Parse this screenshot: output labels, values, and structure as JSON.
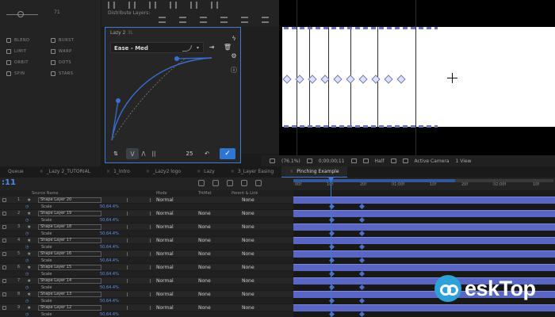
{
  "left_panel": {
    "value": "71",
    "effects": [
      [
        "BLEND",
        "BURST"
      ],
      [
        "LIMIT",
        "WARP"
      ],
      [
        "ORBIT",
        "DOTS"
      ],
      [
        "SPIN",
        "STARS"
      ]
    ]
  },
  "align_panel": {
    "distribute_label": "Distribute Layers:"
  },
  "ease_panel": {
    "title": "Lazy 2",
    "title_sub": "3L",
    "preset": "Ease - Med",
    "frames": "25",
    "footer_buttons": [
      "⇅",
      "\\/",
      "/\\",
      "||"
    ],
    "apply_icon": "✓",
    "undo_icon": "↶",
    "colors": {
      "accent": "#3a7bd5",
      "curve": "#3b6fd4"
    }
  },
  "viewer_toolbar": {
    "zoom": "(76.1%)",
    "timecode": "0;00;00;11",
    "resolution": "Half",
    "camera": "Active Camera",
    "views": "1 View"
  },
  "tabs": [
    {
      "label": "Queue",
      "active": false
    },
    {
      "label": "_Lazy 2_TUTORIAL",
      "active": false
    },
    {
      "label": "1_Intro",
      "active": false
    },
    {
      "label": "_Lazy2 logo",
      "active": false
    },
    {
      "label": "Lazy",
      "active": false
    },
    {
      "label": "3_Layer Easing",
      "active": false
    },
    {
      "label": "Pinching Example",
      "active": true
    }
  ],
  "timeline": {
    "time_display": ":11",
    "ruler_ticks": [
      "00f",
      "10f",
      "20f",
      "01:00f",
      "10f",
      "20f",
      "02:00f",
      "10f"
    ],
    "columns": {
      "source_name": "Source Name",
      "mode": "Mode",
      "trkmat": "TrkMat",
      "parent": "Parent & Link"
    },
    "layers": [
      {
        "num": "1",
        "name": "Shape Layer 20",
        "mode": "Normal",
        "trkmat": "",
        "parent": "None",
        "prop": "Scale",
        "value": "50,64.4%"
      },
      {
        "num": "2",
        "name": "Shape Layer 19",
        "mode": "Normal",
        "trkmat": "None",
        "parent": "None",
        "prop": "Scale",
        "value": "50,64.4%"
      },
      {
        "num": "3",
        "name": "Shape Layer 18",
        "mode": "Normal",
        "trkmat": "None",
        "parent": "None",
        "prop": "Scale",
        "value": "50,64.4%"
      },
      {
        "num": "4",
        "name": "Shape Layer 17",
        "mode": "Normal",
        "trkmat": "None",
        "parent": "None",
        "prop": "Scale",
        "value": "50,64.4%"
      },
      {
        "num": "5",
        "name": "Shape Layer 16",
        "mode": "Normal",
        "trkmat": "None",
        "parent": "None",
        "prop": "Scale",
        "value": "50,64.4%"
      },
      {
        "num": "6",
        "name": "Shape Layer 15",
        "mode": "Normal",
        "trkmat": "None",
        "parent": "None",
        "prop": "Scale",
        "value": "50,64.4%"
      },
      {
        "num": "7",
        "name": "Shape Layer 14",
        "mode": "Normal",
        "trkmat": "None",
        "parent": "None",
        "prop": "Scale",
        "value": "50,64.4%"
      },
      {
        "num": "8",
        "name": "Shape Layer 13",
        "mode": "Normal",
        "trkmat": "None",
        "parent": "None",
        "prop": "Scale",
        "value": "50,64.4%"
      },
      {
        "num": "9",
        "name": "Shape Layer 12",
        "mode": "Normal",
        "trkmat": "None",
        "parent": "None",
        "prop": "Scale",
        "value": "50,64.4%"
      }
    ],
    "track_color": "#5966c4"
  },
  "watermark": {
    "text": "eskTop"
  }
}
